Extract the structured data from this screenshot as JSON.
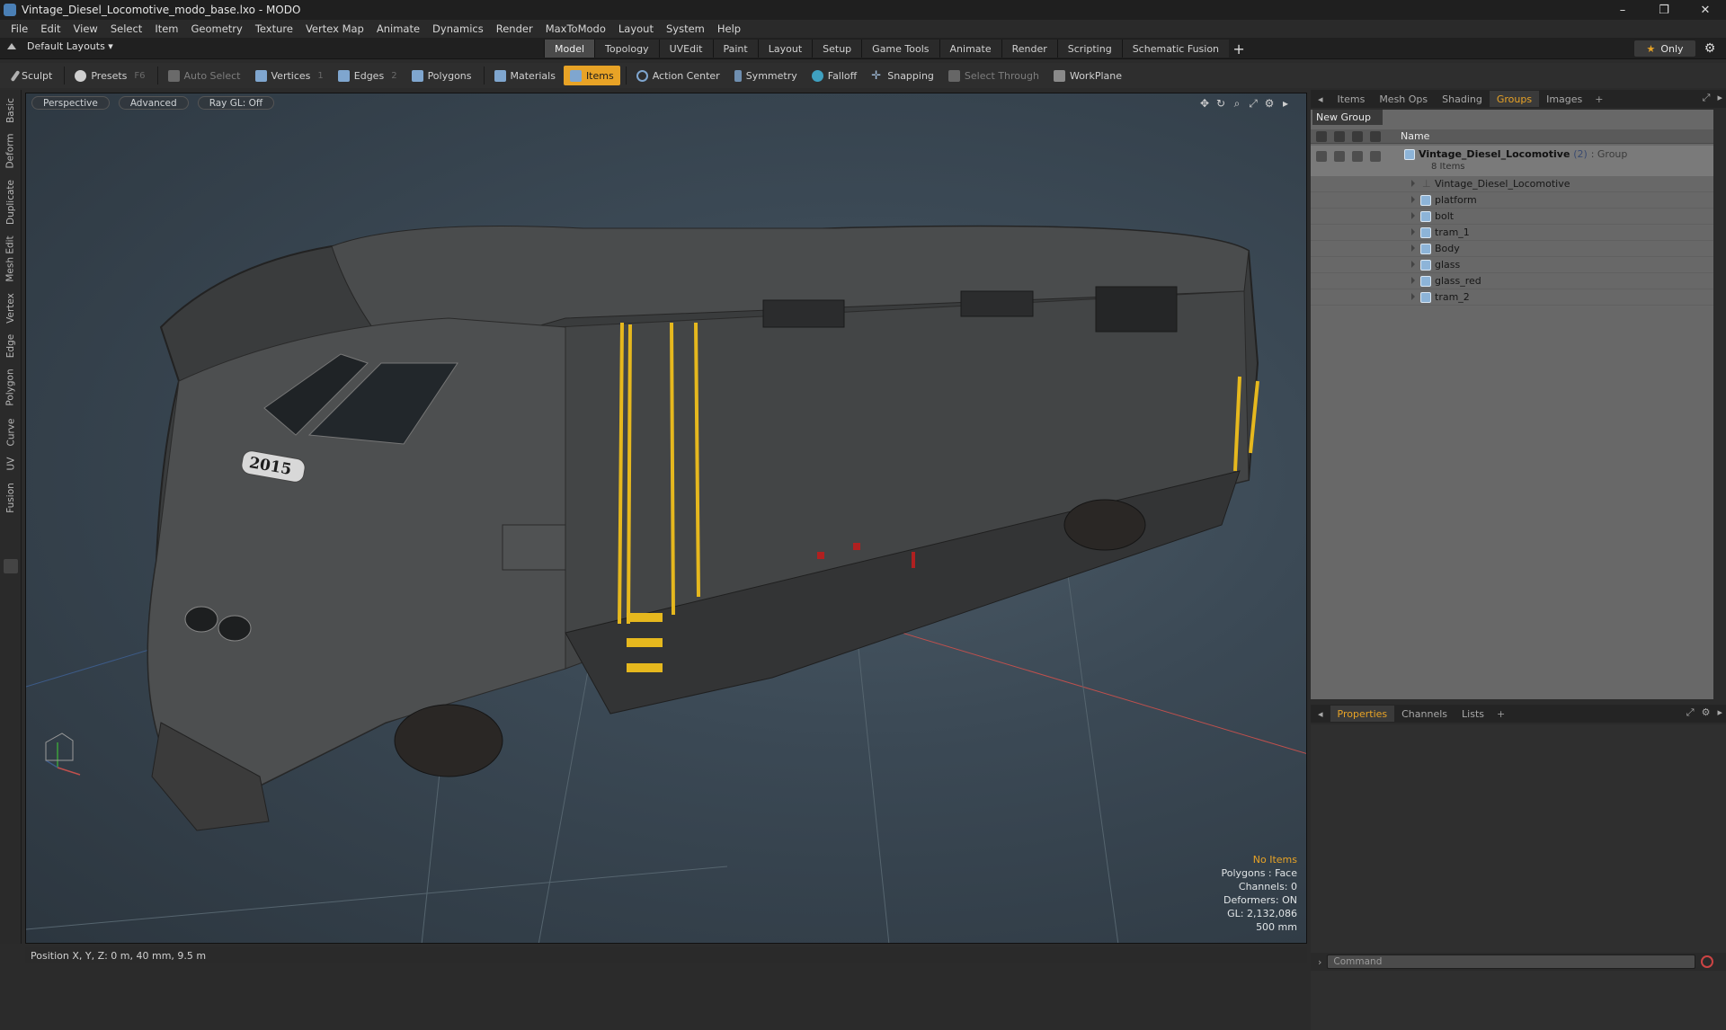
{
  "window": {
    "title": "Vintage_Diesel_Locomotive_modo_base.lxo - MODO",
    "controls": [
      "–",
      "❐",
      "✕"
    ]
  },
  "menubar": [
    "File",
    "Edit",
    "View",
    "Select",
    "Item",
    "Geometry",
    "Texture",
    "Vertex Map",
    "Animate",
    "Dynamics",
    "Render",
    "MaxToModo",
    "Layout",
    "System",
    "Help"
  ],
  "modebar": {
    "layouts": "Default Layouts ▾",
    "tabs": [
      "Model",
      "Topology",
      "UVEdit",
      "Paint",
      "Layout",
      "Setup",
      "Game Tools",
      "Animate",
      "Render",
      "Scripting",
      "Schematic Fusion"
    ],
    "active_tab": "Model",
    "only": "Only"
  },
  "toolbar": {
    "sculpt": "Sculpt",
    "presets": "Presets",
    "presets_key": "F6",
    "auto_select": "Auto Select",
    "vertices": "Vertices",
    "vertices_count": "1",
    "edges": "Edges",
    "edges_count": "2",
    "polygons": "Polygons",
    "materials": "Materials",
    "items": "Items",
    "action_center": "Action Center",
    "symmetry": "Symmetry",
    "falloff": "Falloff",
    "snapping": "Snapping",
    "select_through": "Select Through",
    "workplane": "WorkPlane"
  },
  "left_tabs": [
    "Basic",
    "Deform",
    "Duplicate",
    "Mesh Edit",
    "Vertex",
    "Edge",
    "Polygon",
    "Curve",
    "UV",
    "Fusion"
  ],
  "viewport": {
    "perspective": "Perspective",
    "advanced": "Advanced",
    "raygl": "Ray GL: Off",
    "info": {
      "no_items": "No Items",
      "polygons": "Polygons : Face",
      "channels": "Channels: 0",
      "deformers": "Deformers: ON",
      "gl": "GL: 2,132,086",
      "scale": "500 mm"
    },
    "locomotive_number": "2015"
  },
  "statusbar": {
    "position": "Position X, Y, Z:  0 m, 40 mm, 9.5 m"
  },
  "right_panel": {
    "top_tabs": [
      "Items",
      "Mesh Ops",
      "Shading",
      "Groups",
      "Images"
    ],
    "active_top_tab": "Groups",
    "new_group": "New Group",
    "name_header": "Name",
    "group": {
      "name": "Vintage_Diesel_Locomotive",
      "count": "(2)",
      "type": ": Group",
      "sub": "8 Items"
    },
    "items": [
      "Vintage_Diesel_Locomotive",
      "platform",
      "bolt",
      "tram_1",
      "Body",
      "glass",
      "glass_red",
      "tram_2"
    ],
    "bottom_tabs": [
      "Properties",
      "Channels",
      "Lists"
    ],
    "active_bottom_tab": "Properties",
    "command_placeholder": "Command"
  },
  "colors": {
    "accent": "#e8a326",
    "mesh_icon": "#8db4d8"
  }
}
